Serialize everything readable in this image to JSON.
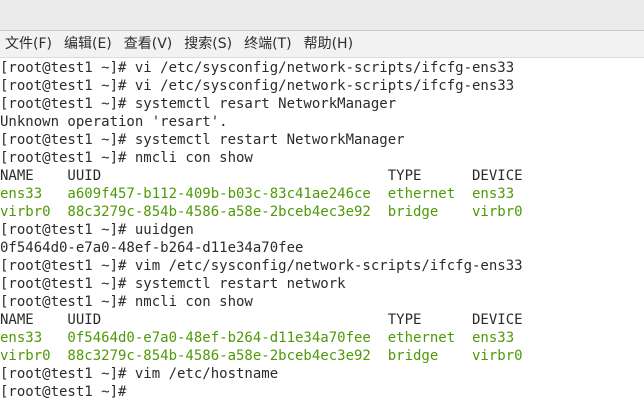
{
  "menu": {
    "items": [
      {
        "label": "文件(F)",
        "name": "menu-file"
      },
      {
        "label": "编辑(E)",
        "name": "menu-edit"
      },
      {
        "label": "查看(V)",
        "name": "menu-view"
      },
      {
        "label": "搜索(S)",
        "name": "menu-search"
      },
      {
        "label": "终端(T)",
        "name": "menu-terminal"
      },
      {
        "label": "帮助(H)",
        "name": "menu-help"
      }
    ]
  },
  "terminal": {
    "lines": [
      {
        "segments": [
          {
            "text": "[root@test1 ~]# vi /etc/sysconfig/network-scripts/ifcfg-ens33"
          }
        ]
      },
      {
        "segments": [
          {
            "text": "[root@test1 ~]# vi /etc/sysconfig/network-scripts/ifcfg-ens33"
          }
        ]
      },
      {
        "segments": [
          {
            "text": "[root@test1 ~]# systemctl resart NetworkManager"
          }
        ]
      },
      {
        "segments": [
          {
            "text": "Unknown operation 'resart'."
          }
        ]
      },
      {
        "segments": [
          {
            "text": "[root@test1 ~]# systemctl restart NetworkManager"
          }
        ]
      },
      {
        "segments": [
          {
            "text": "[root@test1 ~]# nmcli con show"
          }
        ]
      },
      {
        "segments": [
          {
            "text": "NAME    UUID                                  TYPE      DEVICE"
          }
        ]
      },
      {
        "segments": [
          {
            "text": "ens33   a609f457-b112-409b-b03c-83c41ae246ce  ethernet  ens33",
            "color": "green"
          }
        ]
      },
      {
        "segments": [
          {
            "text": "virbr0  88c3279c-854b-4586-a58e-2bceb4ec3e92  bridge    virbr0",
            "color": "green"
          }
        ]
      },
      {
        "segments": [
          {
            "text": "[root@test1 ~]# uuidgen"
          }
        ]
      },
      {
        "segments": [
          {
            "text": "0f5464d0-e7a0-48ef-b264-d11e34a70fee"
          }
        ]
      },
      {
        "segments": [
          {
            "text": "[root@test1 ~]# vim /etc/sysconfig/network-scripts/ifcfg-ens33"
          }
        ]
      },
      {
        "segments": [
          {
            "text": "[root@test1 ~]# systemctl restart network"
          }
        ]
      },
      {
        "segments": [
          {
            "text": "[root@test1 ~]# nmcli con show"
          }
        ]
      },
      {
        "segments": [
          {
            "text": "NAME    UUID                                  TYPE      DEVICE"
          }
        ]
      },
      {
        "segments": [
          {
            "text": "ens33   0f5464d0-e7a0-48ef-b264-d11e34a70fee  ethernet  ens33",
            "color": "green"
          }
        ]
      },
      {
        "segments": [
          {
            "text": "virbr0  88c3279c-854b-4586-a58e-2bceb4ec3e92  bridge    virbr0",
            "color": "green"
          }
        ]
      },
      {
        "segments": [
          {
            "text": "[root@test1 ~]# vim /etc/hostname"
          }
        ]
      },
      {
        "segments": [
          {
            "text": "[root@test1 ~]# "
          }
        ],
        "cursor": true
      }
    ]
  },
  "colors": {
    "output_green": "#4e9a06",
    "text": "#2b2b2b",
    "background": "#ffffff",
    "menubar": "#f2f2f2"
  }
}
